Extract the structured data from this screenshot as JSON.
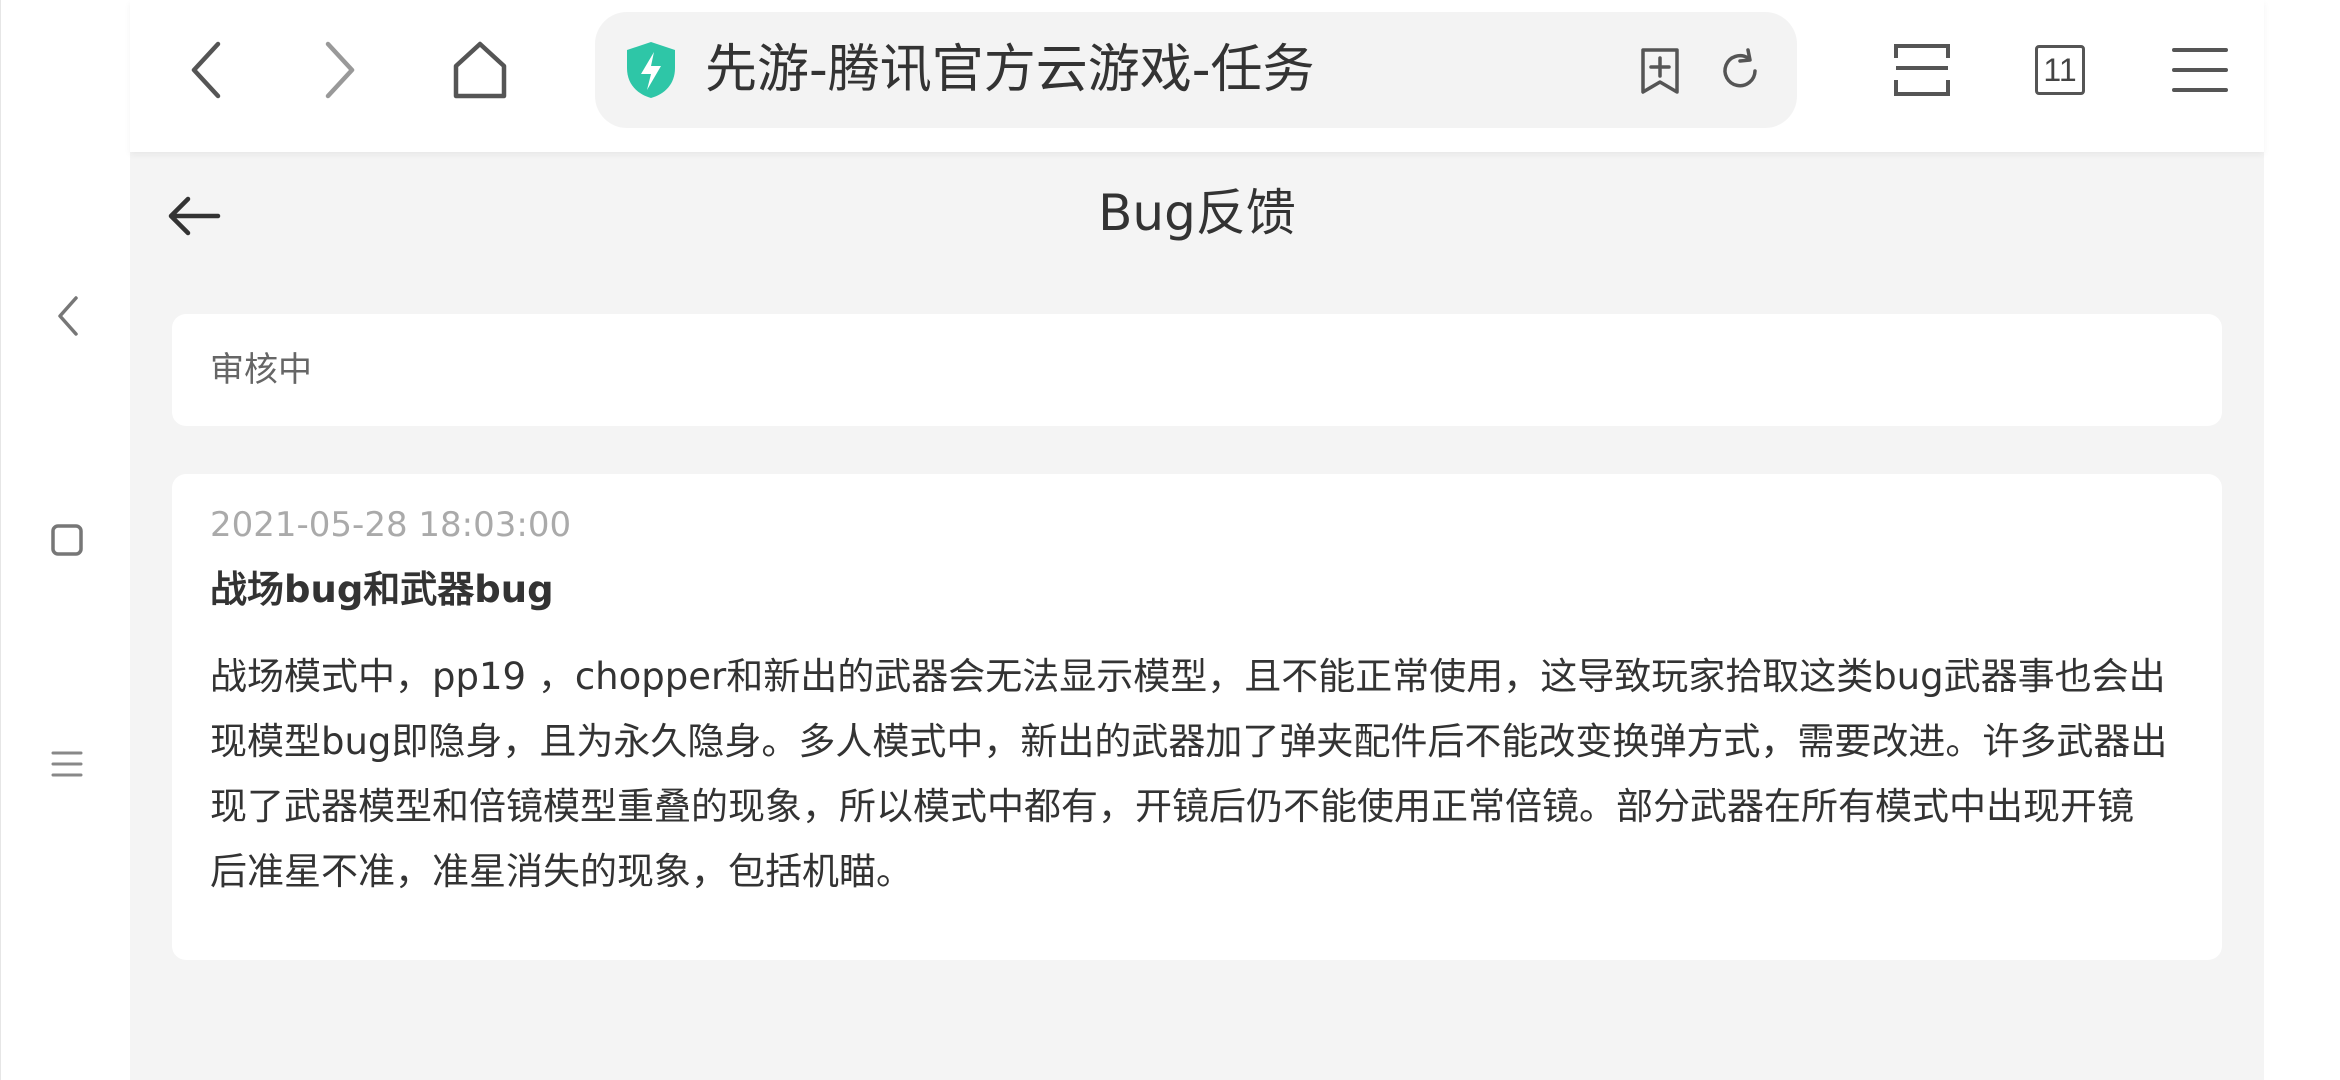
{
  "browser": {
    "tab_title": "先游-腾讯官方云游戏-任务",
    "tab_count": "11",
    "icons": {
      "back": "chevron-left-icon",
      "forward": "chevron-right-icon",
      "home": "home-icon",
      "shield": "security-shield-icon",
      "add_bookmark": "add-bookmark-icon",
      "reload": "reload-icon",
      "reader": "reader-mode-icon",
      "tabs": "tabs-icon",
      "menu": "menu-icon"
    },
    "colors": {
      "shield": "#2ec6a7"
    }
  },
  "left_rail": {
    "icons": [
      "chevron-left-icon",
      "square-icon",
      "menu-lines-icon"
    ]
  },
  "page": {
    "title": "Bug反馈",
    "status": "审核中",
    "feedback": {
      "date": "2021-05-28 18:03:00",
      "title": "战场bug和武器bug",
      "body": "战场模式中，pp19 ，chopper和新出的武器会无法显示模型，且不能正常使用，这导致玩家拾取这类bug武器事也会出现模型bug即隐身，且为永久隐身。多人模式中，新出的武器加了弹夹配件后不能改变换弹方式，需要改进。许多武器出现了武器模型和倍镜模型重叠的现象，所以模式中都有，开镜后仍不能使用正常倍镜。部分武器在所有模式中出现开镜后准星不准，准星消失的现象，包括机瞄。"
    }
  }
}
